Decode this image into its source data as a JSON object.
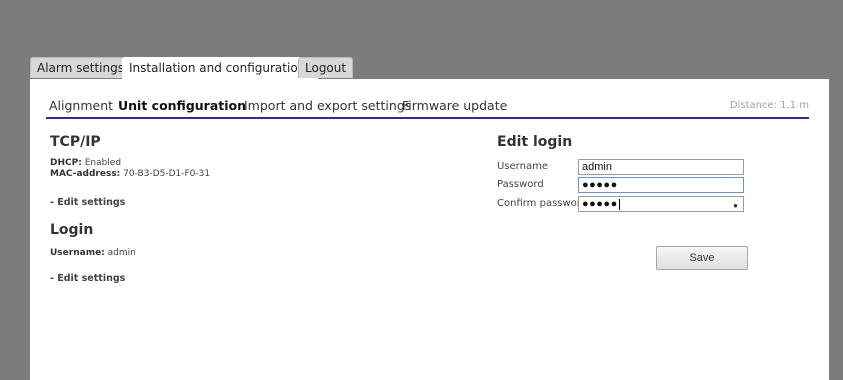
{
  "tabs": [
    {
      "label": "Alarm settings",
      "active": false
    },
    {
      "label": "Installation and configuration",
      "active": true
    },
    {
      "label": "Logout",
      "active": false
    }
  ],
  "subnav": {
    "items": [
      {
        "label": "Alignment",
        "active": false
      },
      {
        "label": "Unit configuration",
        "active": true
      },
      {
        "label": "Import and export settings",
        "active": false
      },
      {
        "label": "Firmware update",
        "active": false
      }
    ],
    "distance": "Distance: 1.1 m"
  },
  "tcpip": {
    "title": "TCP/IP",
    "dhcp_label": "DHCP:",
    "dhcp_value": "Enabled",
    "mac_label": "MAC-address:",
    "mac_value": "70-B3-D5-D1-F0-31",
    "edit_link": "- Edit settings"
  },
  "login": {
    "title": "Login",
    "username_label": "Username:",
    "username_value": "admin",
    "edit_link": "- Edit settings"
  },
  "edit_login": {
    "title": "Edit login",
    "username_label": "Username",
    "username_value": "admin",
    "password_label": "Password",
    "password_value": "●●●●●",
    "confirm_label": "Confirm password",
    "confirm_value": "●●●●●",
    "save_label": "Save"
  },
  "colors": {
    "background": "#7c7c7c",
    "accent_underline": "#2b2f86",
    "focus_border": "#6a93c6"
  },
  "icons": {
    "reveal_password": "eye-icon"
  }
}
